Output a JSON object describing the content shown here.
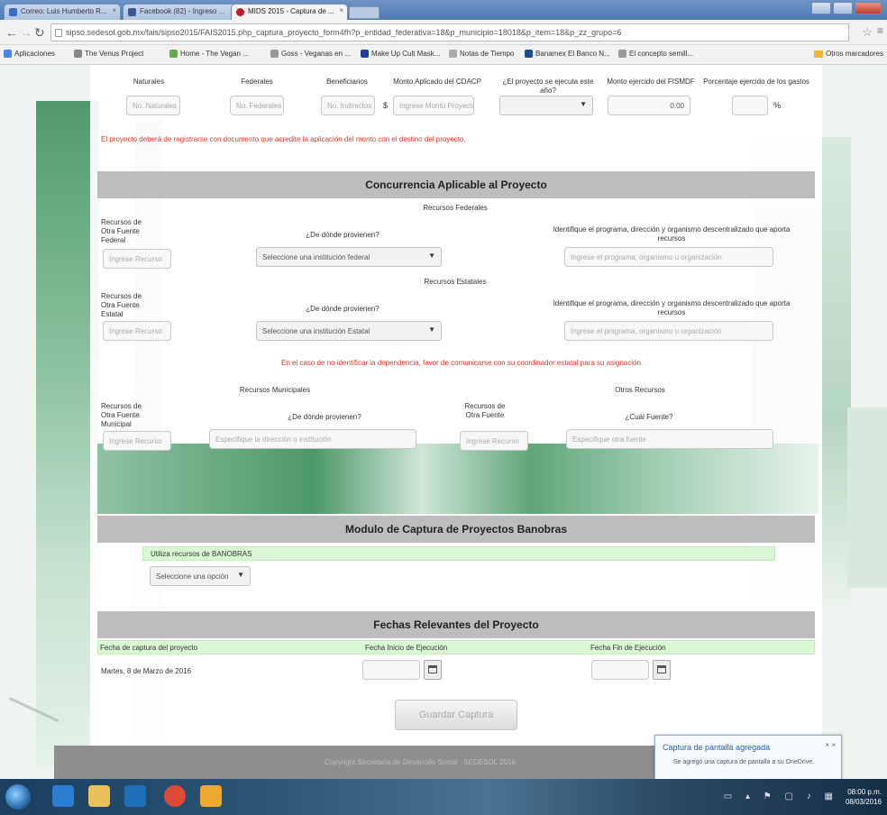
{
  "browser": {
    "tabs": [
      {
        "title": "Correo: Luis Humberto R...",
        "active": false,
        "icon_color": "#3a6fc4"
      },
      {
        "title": "Facebook (82) - Ingreso ...",
        "active": false,
        "icon_color": "#3b5998"
      },
      {
        "title": "MIDS 2015 - Captura de ...",
        "active": true,
        "icon_color": "#c0182a"
      }
    ],
    "url": "sipso.sedesol.gob.mx/fais/sipso2015/FAIS2015.php_captura_proyecto_form4fh?p_entidad_federativa=18&p_municipio=18018&p_item=18&p_zz_grupo=6",
    "bookmarks": [
      {
        "label": "Aplicaciones",
        "color": "#4a86e8"
      },
      {
        "label": "The Venus Project",
        "color": "#888888"
      },
      {
        "label": "Home - The Vegan ...",
        "color": "#6aa84f"
      },
      {
        "label": "Goss - Veganas en ...",
        "color": "#999999"
      },
      {
        "label": "Make Up Cult Mask...",
        "color": "#1f3d99"
      },
      {
        "label": "Notas de Tiempo",
        "color": "#aaaaaa"
      },
      {
        "label": "Banamex El Banco N...",
        "color": "#1d4e89"
      },
      {
        "label": "El concepto semill...",
        "color": "#999999"
      }
    ],
    "other_bookmarks": "Otros marcadores"
  },
  "form": {
    "top_labels": [
      "Naturales",
      "Federales",
      "Beneficiarios",
      "Monto Aplicado del CDACP",
      "¿El proyecto se ejecuta este año?",
      "Monto ejercido del FISMDF",
      "Porcentaje ejercido de los gastos"
    ],
    "top_inputs": [
      "No. Naturales",
      "No. Federales",
      "No. Indirectos",
      "Ingrese Monto Proyecto"
    ],
    "top_currency": "$",
    "top_amount": "0.00",
    "top_percent_suffix": "%",
    "warning_top": "El proyecto deberá de registrarse con documento que acredite la aplicación del monto con el destino del proyecto.",
    "concurrencia": {
      "title": "Concurrencia Aplicable al Proyecto",
      "federal_title": "Recursos Federales",
      "federal_label": "Recursos de Otra Fuente Federal",
      "federal_placeholder": "Ingrese Recurso",
      "federal_question": "¿De dónde provienen?",
      "federal_select": "Seleccione una institución federal",
      "federal_identify": "Identifique el programa, dirección y organismo descentralizado que aporta recursos",
      "federal_identify_placeholder": "Ingrese el programa, organismo u organización",
      "state_title": "Recursos Estatales",
      "state_label": "Recursos de Otra Fuente Estatal",
      "state_placeholder": "Ingrese Recurso",
      "state_question": "¿De dónde provienen?",
      "state_select": "Seleccione una institución Estatal",
      "state_identify": "Identifique el programa, dirección y organismo descentralizado que aporta recursos",
      "state_identify_placeholder": "Ingrese el programa, organismo u organización",
      "warning_mid": "En el caso de no identificar la dependencia, favor de comunicarse con su coordinador estatal para su asignación.",
      "municipal_title": "Recursos Municipales",
      "municipal_label": "Recursos de Otra Fuente Municipal",
      "municipal_placeholder": "Ingrese Recurso",
      "municipal_question": "¿De dónde provienen?",
      "municipal_input": "Especifique la dirección o institución",
      "other_title": "Otros Recursos",
      "other_label": "Recursos de Otra Fuente",
      "other_placeholder": "Ingrese Recurso",
      "other_question": "¿Cuál Fuente?",
      "other_input": "Especifique otra fuente"
    },
    "banobras": {
      "title": "Modulo de Captura de Proyectos Banobras",
      "question": "Utiliza recursos de BANOBRAS",
      "select": "Seleccione una opción"
    },
    "fechas": {
      "title": "Fechas Relevantes del Proyecto",
      "col1": "Fecha de captura del proyecto",
      "col2": "Fecha Inicio de Ejecución",
      "col3": "Fecha Fin de Ejecución",
      "capture_date": "Martes, 8 de Marzo de 2016",
      "start_date": "",
      "end_date": ""
    },
    "save_label": "Guardar Captura"
  },
  "footer": "Copyright Secretaría de Desarrollo Social · SEDESOL 2016",
  "toast": {
    "title": "Captura de pantalla agregada",
    "body": "Se agregó una captura de pantalla a su OneDrive."
  },
  "taskbar": {
    "time": "08:00 p.m.",
    "date": "08/03/2016",
    "apps": [
      {
        "name": "internet-explorer",
        "color": "#2d7dd2"
      },
      {
        "name": "file-explorer",
        "color": "#e8c15a"
      },
      {
        "name": "outlook",
        "color": "#1f6fb8"
      },
      {
        "name": "chrome",
        "color": "#dc4a38"
      },
      {
        "name": "sticky-app",
        "color": "#f0a830"
      }
    ]
  }
}
